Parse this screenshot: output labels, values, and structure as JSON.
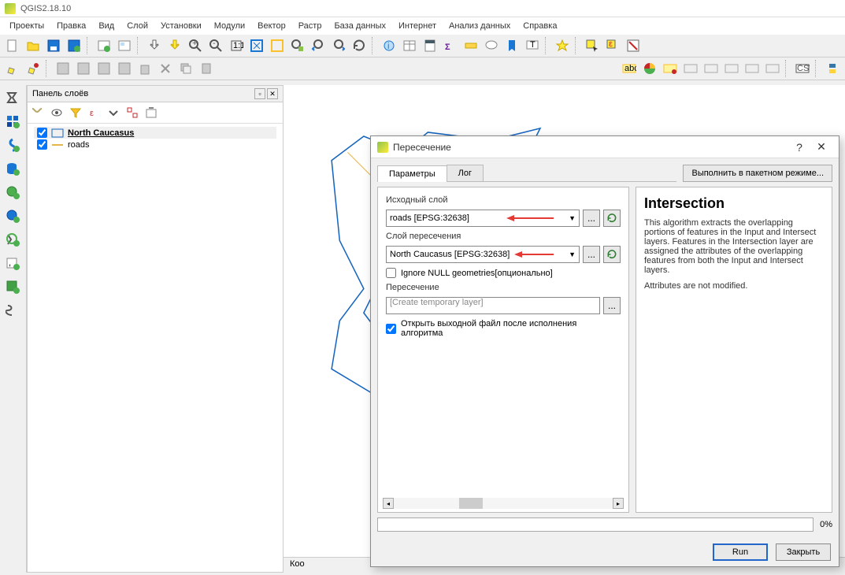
{
  "app_title": "QGIS2.18.10",
  "menu": [
    "Проекты",
    "Правка",
    "Вид",
    "Слой",
    "Установки",
    "Модули",
    "Вектор",
    "Растр",
    "База данных",
    "Интернет",
    "Анализ данных",
    "Справка"
  ],
  "layers_panel_title": "Панель слоёв",
  "layers": [
    {
      "name": "North Caucasus",
      "checked": true,
      "selected": true,
      "color": "#1565c0",
      "type": "polygon"
    },
    {
      "name": "roads",
      "checked": true,
      "selected": false,
      "color": "#e5b648",
      "type": "line"
    }
  ],
  "statusbar_coord_label": "Коо",
  "dialog": {
    "title": "Пересечение",
    "tabs": [
      "Параметры",
      "Лог"
    ],
    "batch_button": "Выполнить в пакетном режиме...",
    "fields": {
      "input_label": "Исходный слой",
      "input_value": "roads [EPSG:32638]",
      "intersect_label": "Слой пересечения",
      "intersect_value": "North Caucasus [EPSG:32638]",
      "ignore_null_label": "Ignore NULL geometries[опционально]",
      "ignore_null_checked": false,
      "output_label": "Пересечение",
      "output_placeholder": "[Create temporary layer]",
      "open_output_label": "Открыть выходной файл после исполнения алгоритма",
      "open_output_checked": true
    },
    "help_title": "Intersection",
    "help_p1": "This algorithm extracts the overlapping portions of features in the Input and Intersect layers. Features in the Intersection layer are assigned the attributes of the overlapping features from both the Input and Intersect layers.",
    "help_p2": "Attributes are not modified.",
    "progress_pct": "0%",
    "run_button": "Run",
    "close_button": "Закрыть"
  }
}
